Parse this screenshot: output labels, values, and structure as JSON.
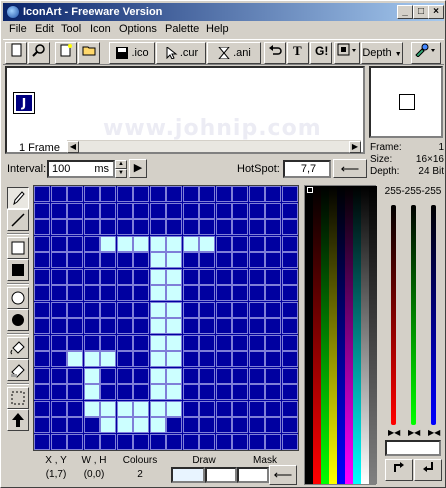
{
  "title": "IconArt - Freeware Version",
  "window_buttons": {
    "min": "_",
    "max": "□",
    "close": "×"
  },
  "menu": [
    "File",
    "Edit",
    "Tool",
    "Icon",
    "Options",
    "Palette",
    "Help"
  ],
  "toolbar": {
    "save_ico": ".ico",
    "save_cur": ".cur",
    "save_ani": ".ani",
    "depth": "Depth"
  },
  "frames": {
    "count_label": "1 Frame",
    "thumb_letter": "J"
  },
  "watermark": "www.johnip.com",
  "info": {
    "frame_label": "Frame:",
    "frame_value": "1",
    "size_label": "Size:",
    "size_value": "16×16",
    "depth_label": "Depth:",
    "depth_value": "24 Bit"
  },
  "interval": {
    "label": "Interval:",
    "value": "100",
    "unit": "ms"
  },
  "hotspot": {
    "label": "HotSpot:",
    "value": "7,7"
  },
  "status": {
    "xy_label": "X , Y",
    "xy_value": "(1,7)",
    "wh_label": "W , H",
    "wh_value": "(0,0)",
    "colours_label": "Colours",
    "colours_value": "2",
    "draw_label": "Draw",
    "mask_label": "Mask"
  },
  "rgb_readout": "255-255-255",
  "colors": {
    "grid_bg": "#0000a0",
    "pixel_on": "#ccffff",
    "gridline": "#7f7fd8"
  },
  "icon_pixels": [
    "0000000000000000",
    "0000000000000000",
    "0000000000000000",
    "0000111111100000",
    "0000000110000000",
    "0000000110000000",
    "0000000110000000",
    "0000000110000000",
    "0000000110000000",
    "0000000110000000",
    "0011100110000000",
    "0001000110000000",
    "0001000110000000",
    "0001111110000000",
    "0000111100000000",
    "0000000000000000"
  ]
}
